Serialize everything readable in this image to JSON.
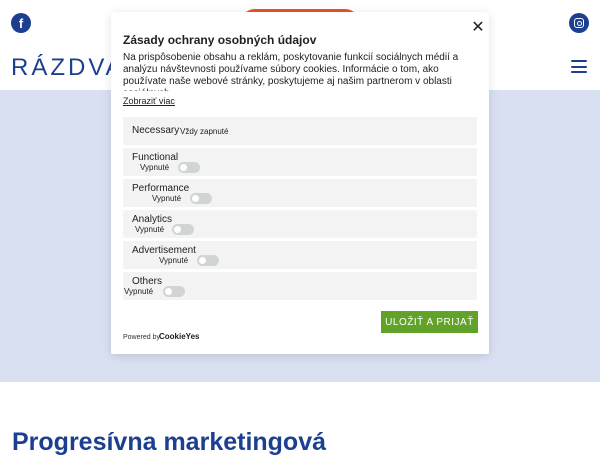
{
  "site": {
    "logo_text": "RÁZDVA",
    "headline": "Progresívna marketingová"
  },
  "icons": {
    "facebook": "facebook-icon",
    "instagram": "instagram-icon",
    "menu": "hamburger-menu-icon",
    "close": "close-icon"
  },
  "colors": {
    "brand_blue": "#1d3f8f",
    "accent_orange": "#e8542a",
    "hero_band": "#d8e0f2",
    "save_green": "#61a229"
  },
  "cookie_modal": {
    "title": "Zásady ochrany osobných údajov",
    "description": "Na prispôsobenie obsahu a reklám, poskytovanie funkcií sociálnych médií a analýzu návštevnosti používame súbory cookies. Informácie o tom, ako používate naše webové stránky, poskytujeme aj našim partnerom v oblasti sociálnych",
    "show_more": "Zobraziť viac",
    "categories": [
      {
        "name": "Necessary",
        "status": "Vždy zapnuté"
      },
      {
        "name": "Functional",
        "status": "Vypnuté"
      },
      {
        "name": "Performance",
        "status": "Vypnuté"
      },
      {
        "name": "Analytics",
        "status": "Vypnuté"
      },
      {
        "name": "Advertisement",
        "status": "Vypnuté"
      },
      {
        "name": "Others",
        "status": "Vypnuté"
      }
    ],
    "save_button": "ULOŽIŤ A PRIJAŤ",
    "powered_by": "Powered by",
    "brand": "CookieYes"
  }
}
